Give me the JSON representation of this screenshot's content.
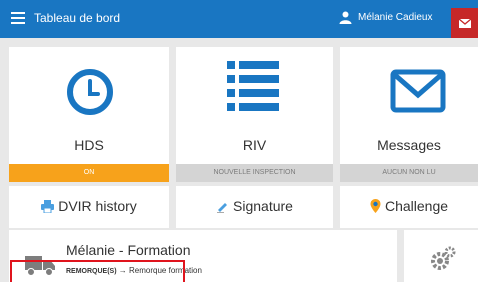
{
  "topbar": {
    "title": "Tableau de bord",
    "user_name": "Mélanie Cadieux"
  },
  "tiles": [
    {
      "label": "HDS",
      "status": "ON",
      "status_color": "#f7a21b",
      "icon": "clock-icon"
    },
    {
      "label": "RIV",
      "status": "NOUVELLE INSPECTION",
      "icon": "list-icon"
    },
    {
      "label": "Messages",
      "status": "AUCUN NON LU",
      "icon": "envelope-icon"
    }
  ],
  "shortcuts": [
    {
      "label": "DVIR history",
      "icon": "printer-icon"
    },
    {
      "label": "Signature",
      "icon": "pen-icon"
    },
    {
      "label": "Challenge",
      "icon": "map-pin-icon"
    }
  ],
  "trip": {
    "title": "Mélanie - Formation",
    "trailer_label": "REMORQUE(S)",
    "trailer_value": "→ Remorque formation",
    "icon": "truck-icon"
  },
  "settings": {
    "icon": "gears-icon"
  },
  "colors": {
    "primary": "#1976c2",
    "accent": "#f7a21b",
    "alert": "#c62828"
  }
}
